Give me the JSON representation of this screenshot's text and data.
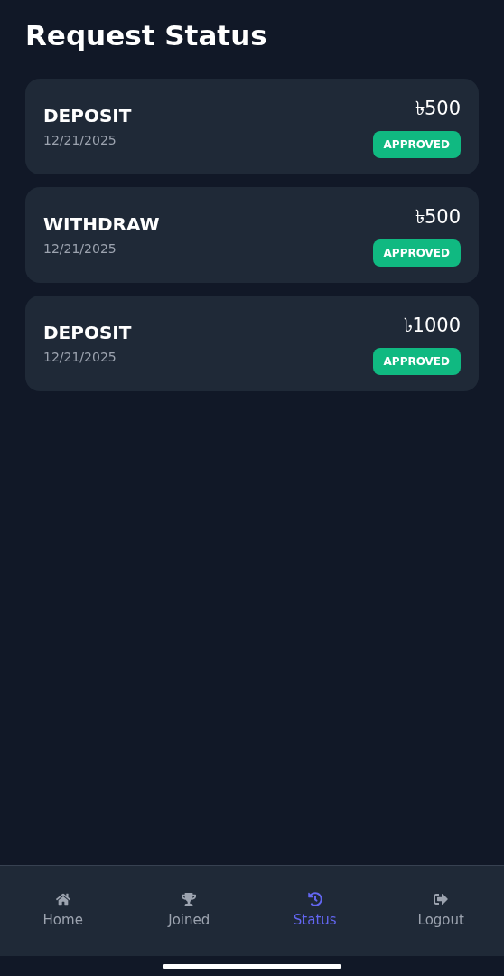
{
  "title": "Request Status",
  "requests": [
    {
      "type": "DEPOSIT",
      "date": "12/21/2025",
      "amount": "৳500",
      "status": "APPROVED"
    },
    {
      "type": "WITHDRAW",
      "date": "12/21/2025",
      "amount": "৳500",
      "status": "APPROVED"
    },
    {
      "type": "DEPOSIT",
      "date": "12/21/2025",
      "amount": "৳1000",
      "status": "APPROVED"
    }
  ],
  "nav": [
    {
      "kind": "home",
      "label": "Home",
      "selected": false
    },
    {
      "kind": "trophy",
      "label": "Joined",
      "selected": false
    },
    {
      "kind": "history",
      "label": "Status",
      "selected": true
    },
    {
      "kind": "logout",
      "label": "Logout",
      "selected": false
    }
  ]
}
